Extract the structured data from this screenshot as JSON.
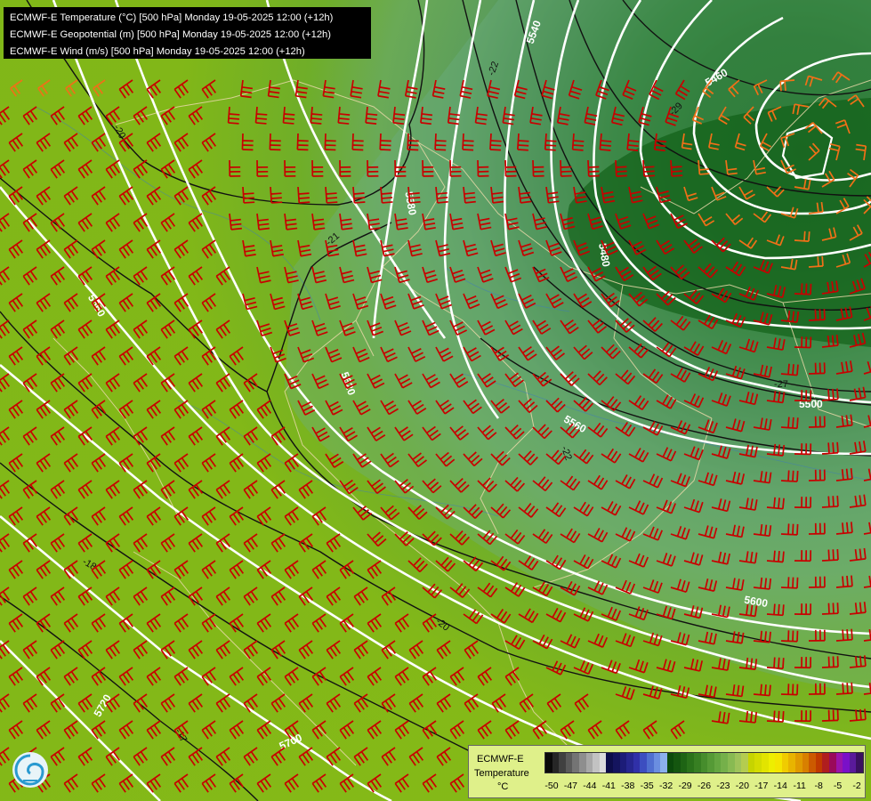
{
  "header": {
    "lines": [
      "ECMWF-E Temperature (°C) [500 hPa] Monday 19-05-2025 12:00 (+12h)",
      "ECMWF-E Geopotential (m) [500 hPa] Monday 19-05-2025 12:00 (+12h)",
      "ECMWF-E Wind (m/s) [500 hPa] Monday 19-05-2025 12:00 (+12h)"
    ]
  },
  "legend": {
    "title1": "ECMWF-E",
    "title2": "Temperature",
    "unit": "°C",
    "ticks": [
      "-50",
      "-47",
      "-44",
      "-41",
      "-38",
      "-35",
      "-32",
      "-29",
      "-26",
      "-23",
      "-20",
      "-17",
      "-14",
      "-11",
      "-8",
      "-5",
      "-2"
    ],
    "colors": [
      "#0a0a0a",
      "#262626",
      "#404040",
      "#5a5a5a",
      "#747474",
      "#8e8e8e",
      "#a8a8a8",
      "#c2c2c2",
      "#dcdcdc",
      "#0d0d4a",
      "#14145e",
      "#1c1c78",
      "#26268f",
      "#3030a8",
      "#3c4ec0",
      "#4f6fd0",
      "#6a8ee0",
      "#8bb0ee",
      "#0b4a0b",
      "#14560f",
      "#1e6414",
      "#2a721a",
      "#377f22",
      "#468d2c",
      "#559a36",
      "#64a640",
      "#75b04a",
      "#88ba52",
      "#9ec35a",
      "#b4cc50",
      "#c6d400",
      "#d4dc00",
      "#e2e400",
      "#eeee00",
      "#f4e600",
      "#f0cc00",
      "#e8b400",
      "#e09a00",
      "#d88000",
      "#cc5a00",
      "#c03a00",
      "#b01e1e",
      "#9a0a5a",
      "#9a14aa",
      "#7a10c8",
      "#5a1a9a",
      "#3a1060"
    ]
  },
  "geopotential_labels": [
    "5540",
    "5460",
    "5580",
    "5480",
    "5620",
    "5560",
    "5500",
    "5600",
    "5660",
    "5720",
    "5700",
    "5660"
  ],
  "temperature_labels": [
    "-22",
    "-29",
    "-21",
    "-20",
    "-18",
    "-20",
    "-17",
    "-22",
    "-27"
  ]
}
